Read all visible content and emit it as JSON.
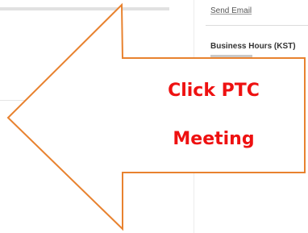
{
  "sidebar": {
    "send_email_label": "Send Email",
    "business_hours_heading": "Business Hours (KST)"
  },
  "callout": {
    "line1": "Click PTC",
    "line2": "Meeting",
    "text_color": "#ee1111",
    "arrow_stroke_color": "#e8822f",
    "arrow_fill_color": "#ffffff",
    "direction": "left"
  }
}
